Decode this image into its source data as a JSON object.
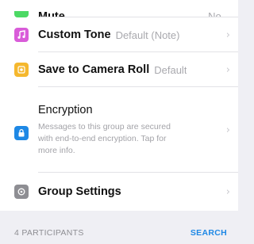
{
  "rows": {
    "mute": {
      "label": "Mute",
      "value": "No",
      "icon": "speaker-icon",
      "color": "#4cd964"
    },
    "custom_tone": {
      "label": "Custom Tone",
      "value": "Default (Note)",
      "icon": "music-note-icon",
      "color": "#d95cd9"
    },
    "save_to_camera_roll": {
      "label": "Save to Camera Roll",
      "value": "Default",
      "icon": "sun-icon",
      "color": "#f5b82e"
    },
    "encryption": {
      "label": "Encryption",
      "description": "Messages to this group are secured with end-to-end encryption. Tap for more info.",
      "icon": "lock-icon",
      "color": "#1e88e5"
    },
    "group_settings": {
      "label": "Group Settings",
      "icon": "gear-icon",
      "color": "#8e8e93"
    }
  },
  "participants": {
    "label": "4 PARTICIPANTS",
    "search_label": "SEARCH"
  },
  "colors": {
    "accent": "#1e88e5",
    "background": "#efeff4"
  }
}
